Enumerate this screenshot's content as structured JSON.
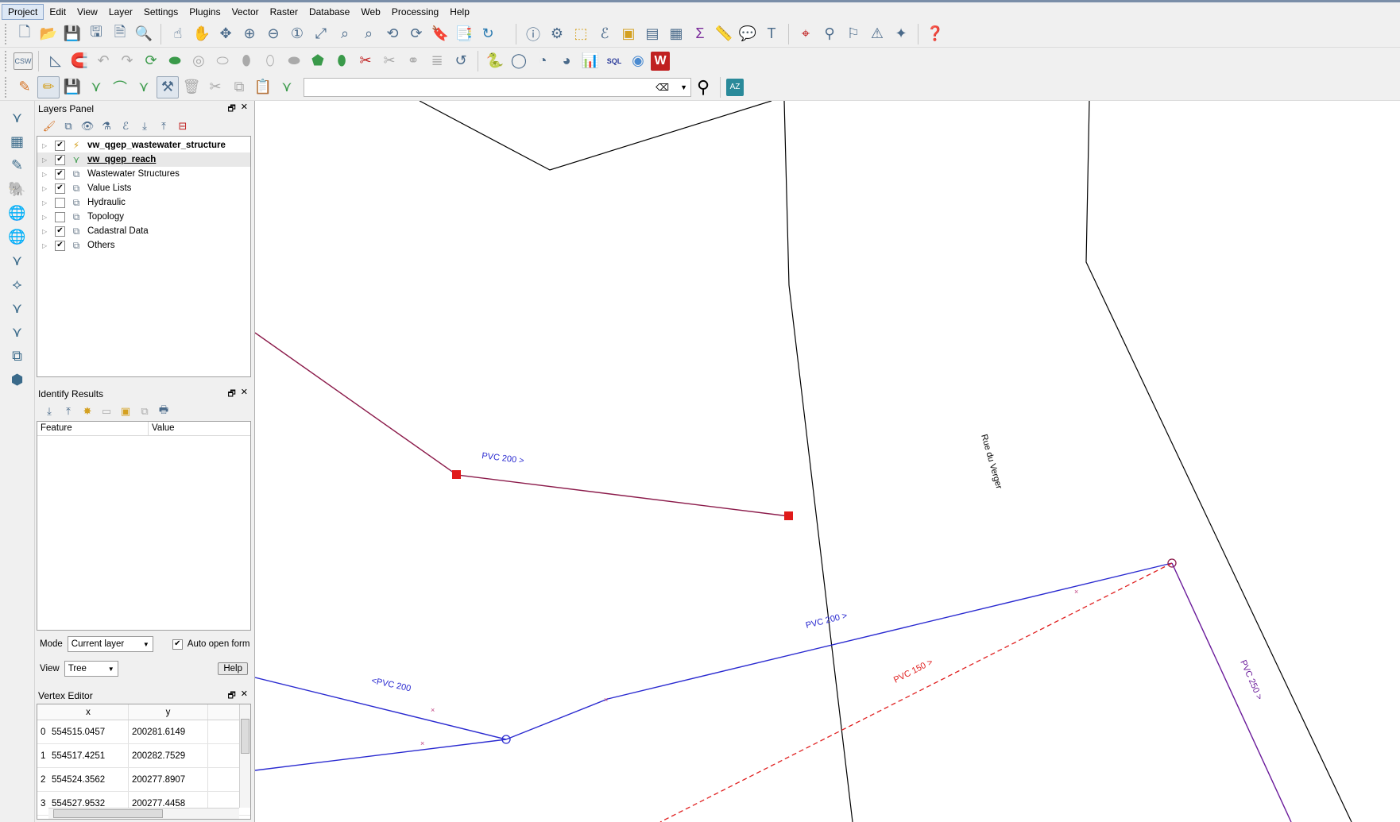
{
  "menubar": {
    "items": [
      "Project",
      "Edit",
      "View",
      "Layer",
      "Settings",
      "Plugins",
      "Vector",
      "Raster",
      "Database",
      "Web",
      "Processing",
      "Help"
    ]
  },
  "toolbar": {
    "csw_label": "CSW",
    "sql_label": "SQL",
    "az_label": "AZ",
    "search_placeholder": ""
  },
  "layers_panel": {
    "title": "Layers Panel",
    "layers": [
      {
        "name": "vw_qgep_wastewater_structure",
        "checked": true,
        "icon": "line-edit-icon"
      },
      {
        "name": "vw_qgep_reach",
        "checked": true,
        "icon": "line-layer-icon"
      },
      {
        "name": "Wastewater Structures",
        "checked": true,
        "icon": "group-icon"
      },
      {
        "name": "Value Lists",
        "checked": true,
        "icon": "group-icon"
      },
      {
        "name": "Hydraulic",
        "checked": false,
        "icon": "group-icon"
      },
      {
        "name": "Topology",
        "checked": false,
        "icon": "group-icon"
      },
      {
        "name": "Cadastral Data",
        "checked": true,
        "icon": "group-icon"
      },
      {
        "name": "Others",
        "checked": true,
        "icon": "group-icon"
      }
    ]
  },
  "identify_panel": {
    "title": "Identify Results",
    "col_feature": "Feature",
    "col_value": "Value",
    "mode_label": "Mode",
    "mode_value": "Current layer",
    "auto_open_label": "Auto open form",
    "auto_open_checked": true,
    "view_label": "View",
    "view_value": "Tree",
    "help_label": "Help"
  },
  "vertex_editor": {
    "title": "Vertex Editor",
    "col_x": "x",
    "col_y": "y",
    "rows": [
      {
        "idx": "0",
        "x": "554515.0457",
        "y": "200281.6149"
      },
      {
        "idx": "1",
        "x": "554517.4251",
        "y": "200282.7529"
      },
      {
        "idx": "2",
        "x": "554524.3562",
        "y": "200277.8907"
      },
      {
        "idx": "3",
        "x": "554527.9532",
        "y": "200277.4458"
      }
    ]
  },
  "map": {
    "labels": {
      "pvc200_upper": "PVC 200 >",
      "pvc200_left": "<PVC 200",
      "pvc200_blue": "PVC 200 >",
      "pvc150": "PVC 150 >",
      "pvc250": "PVC 250 >",
      "street": "Rue du Verger"
    },
    "colors": {
      "cadastral": "#000000",
      "reach_upper": "#8b1a4a",
      "reach_blue": "#2a2ad0",
      "reach_dashed": "#e02020",
      "reach_purple": "#6a1a9a",
      "node_red": "#e01a1a"
    }
  }
}
